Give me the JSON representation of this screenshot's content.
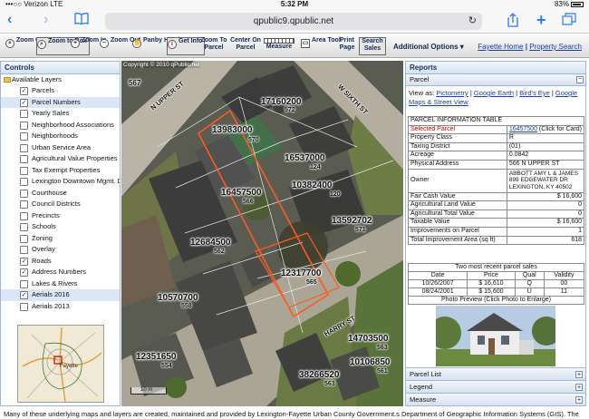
{
  "status_bar": {
    "carrier": "•••○○ Verizon  LTE",
    "time": "5:32 PM",
    "battery": "83%"
  },
  "browser": {
    "url": "qpublic9.qpublic.net",
    "reload_icon": "reload-icon"
  },
  "toolbar": {
    "tools": [
      {
        "label": "Zoom County",
        "icon": "zoom-county-icon"
      },
      {
        "label": "Zoom to Box",
        "icon": "zoom-box-icon"
      },
      {
        "label": "Zoom In",
        "icon": "zoom-in-icon"
      },
      {
        "label": "Zoom Out",
        "icon": "zoom-out-icon"
      },
      {
        "label": "Panby Hand",
        "icon": "pan-hand-icon"
      },
      {
        "label": "Get Info",
        "icon": "info-icon"
      },
      {
        "label": "Zoom To Parcel",
        "icon": ""
      },
      {
        "label": "Center On Parcel",
        "icon": ""
      },
      {
        "label": "Measure",
        "icon": "ruler-icon"
      },
      {
        "label": "Area Tool",
        "icon": "area-icon"
      },
      {
        "label": "Print Page",
        "icon": ""
      },
      {
        "label": "Search Sales",
        "icon": ""
      }
    ],
    "advanced_options": "Additional Options ▾",
    "fayette_home": "Fayette Home",
    "separator": "|",
    "property_search": "Property Search"
  },
  "controls": {
    "title": "Controls",
    "root_label": "Available Layers",
    "layers": [
      {
        "label": "Parcels",
        "checked": true
      },
      {
        "label": "Parcel Numbers",
        "checked": true,
        "selected": true
      },
      {
        "label": "Yearly Sales",
        "checked": false
      },
      {
        "label": "Neighborhood Associations",
        "checked": false
      },
      {
        "label": "Neighborhoods",
        "checked": false
      },
      {
        "label": "Urban Service Area",
        "checked": false
      },
      {
        "label": "Agricultural Value Properties",
        "checked": false
      },
      {
        "label": "Tax Exempt Properties",
        "checked": false
      },
      {
        "label": "Lexington Downtown Mgmt. D",
        "checked": false
      },
      {
        "label": "Courthouse",
        "checked": false
      },
      {
        "label": "Council Districts",
        "checked": false
      },
      {
        "label": "Precincts",
        "checked": false
      },
      {
        "label": "Schools",
        "checked": false
      },
      {
        "label": "Zoning",
        "checked": false
      },
      {
        "label": "Overlay",
        "checked": false
      },
      {
        "label": "Roads",
        "checked": true
      },
      {
        "label": "Address Numbers",
        "checked": true
      },
      {
        "label": "Lakes & Rivers",
        "checked": false
      },
      {
        "label": "Aerials 2016",
        "checked": true,
        "selected": true
      },
      {
        "label": "Aerials 2013",
        "checked": false
      }
    ],
    "overview_label": "Fayette"
  },
  "map": {
    "copyright": "Copyright © 2010 qPublic.net",
    "streets": {
      "n_upper": "N UPPER ST",
      "w_sixth": "W SIXTH ST",
      "harry": "HARRY ST"
    },
    "parcels": [
      {
        "num": "567",
        "addr": ""
      },
      {
        "num": "17160200",
        "addr": "572"
      },
      {
        "num": "13983000",
        "addr": "570"
      },
      {
        "num": "16537000",
        "addr": "124"
      },
      {
        "num": "10382400",
        "addr": "120"
      },
      {
        "num": "16457500",
        "addr": "566"
      },
      {
        "num": "13592702",
        "addr": "571"
      },
      {
        "num": "12684500",
        "addr": "562"
      },
      {
        "num": "12317700",
        "addr": "565"
      },
      {
        "num": "10570700",
        "addr": "558"
      },
      {
        "num": "14703500",
        "addr": "563"
      },
      {
        "num": "12351650",
        "addr": "554"
      },
      {
        "num": "10106850",
        "addr": "561"
      },
      {
        "num": "38266520",
        "addr": "563"
      }
    ],
    "scale_label": "10 m"
  },
  "reports": {
    "title": "Reports",
    "parcel_head": "Parcel",
    "view_as_label": "View as:",
    "view_links": [
      "Pictometry",
      "Google Earth",
      "Bird's Eye",
      "Google Maps & Street View"
    ],
    "table_title": "PARCEL INFORMATION TABLE",
    "rows": [
      {
        "k": "Selected Parcel",
        "v": "16457500",
        "extra": " (Click for Card)"
      },
      {
        "k": "Property Class",
        "v": "R"
      },
      {
        "k": "Taxing District",
        "v": "(01)"
      },
      {
        "k": "Acreage",
        "v": "0.0842"
      },
      {
        "k": "Physical Address",
        "v": "566 N UPPER ST"
      },
      {
        "k": "Owner",
        "v": "ABBOTT AMY L & JAMES\n899 EDGEWATER DR\nLEXINGTON, KY 40502"
      },
      {
        "k": "Fair Cash Value",
        "v": "$ 16,600"
      },
      {
        "k": "Agricultural Land Value",
        "v": "0"
      },
      {
        "k": "Agricultural Total Value",
        "v": "0"
      },
      {
        "k": "Taxable Value",
        "v": "$ 16,600"
      },
      {
        "k": "Improvements on Parcel",
        "v": "1"
      },
      {
        "k": "Total Improvement Area (sq ft)",
        "v": "618"
      }
    ],
    "sales_title": "Two most recent parcel sales",
    "sales_headers": [
      "Date",
      "Price",
      "Qual",
      "Validity"
    ],
    "sales": [
      [
        "10/26/2007",
        "$ 16,610",
        "Q",
        "00"
      ],
      [
        "08/24/2001",
        "$ 15,600",
        "U",
        "11"
      ]
    ],
    "photo_caption": "Photo Preview (Click Photo to Enlarge)",
    "parcel_list": "Parcel List",
    "legend": "Legend",
    "measure": "Measure"
  },
  "footer": "Many of these underlying maps and layers are created, maintained and provided by Lexington-Fayette Urban County Government.s Department of Geographic Information Systems (GIS). The"
}
